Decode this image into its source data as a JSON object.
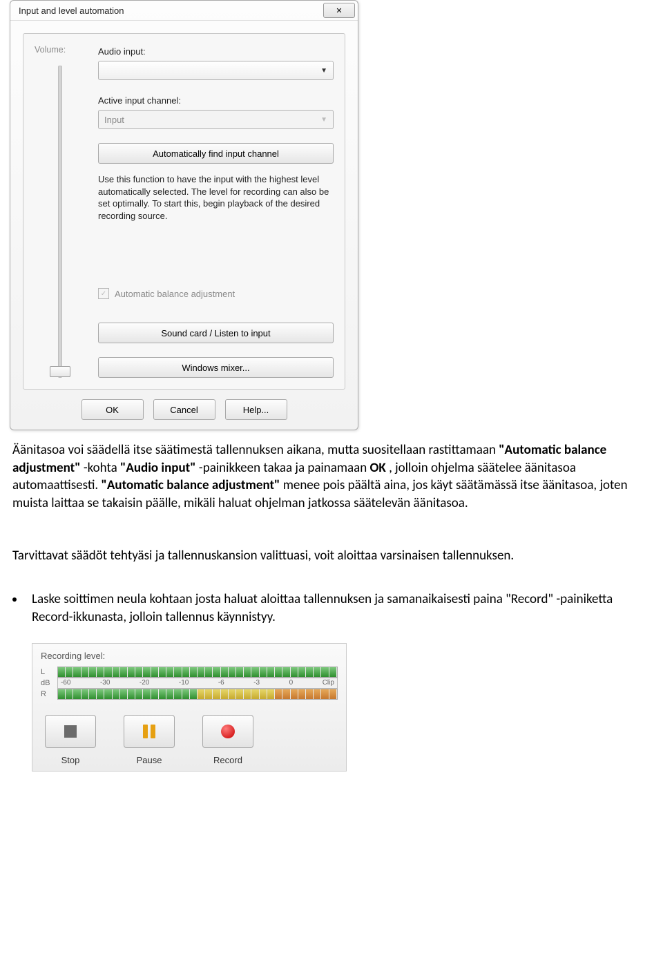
{
  "dialog": {
    "title": "Input and level automation",
    "close_glyph": "✕",
    "volume_label": "Volume:",
    "audio_input_label": "Audio input:",
    "active_channel_label": "Active input channel:",
    "active_channel_value": "Input",
    "auto_find_button": "Automatically find input channel",
    "help_text": "Use this function to have the input with the highest level automatically selected. The level for recording can also be set optimally. To start this, begin playback of the desired recording source.",
    "auto_balance_label": "Automatic balance adjustment",
    "soundcard_button": "Sound card / Listen to input",
    "mixer_button": "Windows mixer...",
    "ok": "OK",
    "cancel": "Cancel",
    "help": "Help..."
  },
  "doc": {
    "p1_prefix": " Äänitasoa voi säädellä itse säätimestä tallennuksen aikana, mutta suositellaan rastittamaan ",
    "p1_b1": "\"Automatic balance adjustment\"",
    "p1_mid1": "-kohta ",
    "p1_b2": "\"Audio input\"",
    "p1_mid2": "-painikkeen takaa ja painamaan ",
    "p1_b3": "OK",
    "p1_mid3": ", jolloin ohjelma säätelee äänitasoa automaattisesti. ",
    "p1_b4": "\"Automatic balance adjustment\"",
    "p1_end": " menee pois päältä aina, jos käyt säätämässä itse äänitasoa, joten muista laittaa se takaisin päälle, mikäli haluat ohjelman jatkossa säätelevän äänitasoa.",
    "p2": "Tarvittavat säädöt tehtyäsi ja tallennuskansion valittuasi, voit aloittaa varsinaisen tallennuksen.",
    "bullet_prefix": "Laske soittimen neula kohtaan josta haluat aloittaa tallennuksen ja samanaikaisesti paina ",
    "bullet_b": "\"Record\"",
    "bullet_end": "-painiketta Record-ikkunasta, jolloin tallennus käynnistyy."
  },
  "rec": {
    "title": "Recording level:",
    "l": "L",
    "r": "R",
    "db": "dB",
    "ticks": [
      "-60",
      "-30",
      "-20",
      "-10",
      "-6",
      "-3",
      "0",
      "Clip"
    ],
    "stop": "Stop",
    "pause": "Pause",
    "record": "Record"
  }
}
